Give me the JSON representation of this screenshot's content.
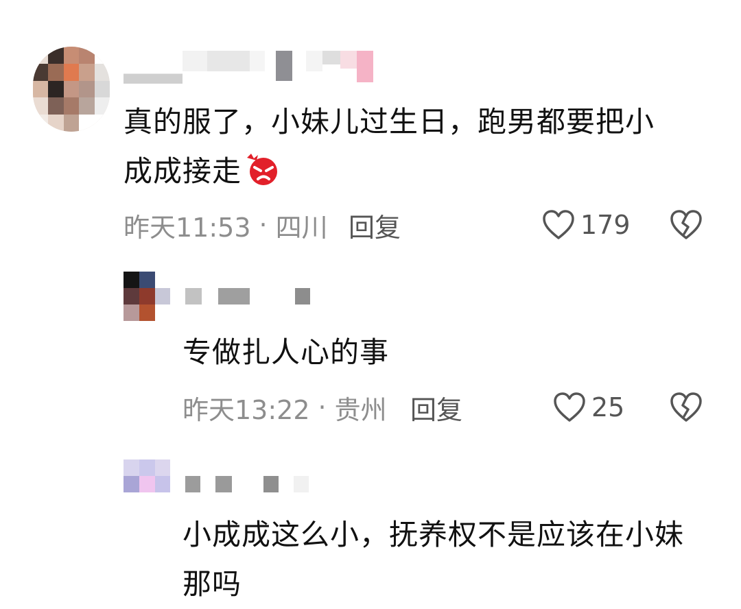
{
  "comments": [
    {
      "text_line1": "真的服了，小妹儿过生日，跑男都要把小",
      "text_line2": "成成接走",
      "emoji": "angry-face-emoji",
      "time": "昨天11:53",
      "separator": "·",
      "region": "四川",
      "reply_label": "回复",
      "likes": "179"
    },
    {
      "text_line1": "专做扎人心的事",
      "time": "昨天13:22",
      "separator": "·",
      "region": "贵州",
      "reply_label": "回复",
      "likes": "25"
    },
    {
      "text_line1": "小成成这么小，抚养权不是应该在小妹",
      "text_line2": "那吗"
    }
  ],
  "icons": {
    "like": "heart-outline-icon",
    "dislike": "broken-heart-icon"
  },
  "colors": {
    "text": "#111111",
    "meta": "#8d8d8d",
    "action": "#555555"
  }
}
